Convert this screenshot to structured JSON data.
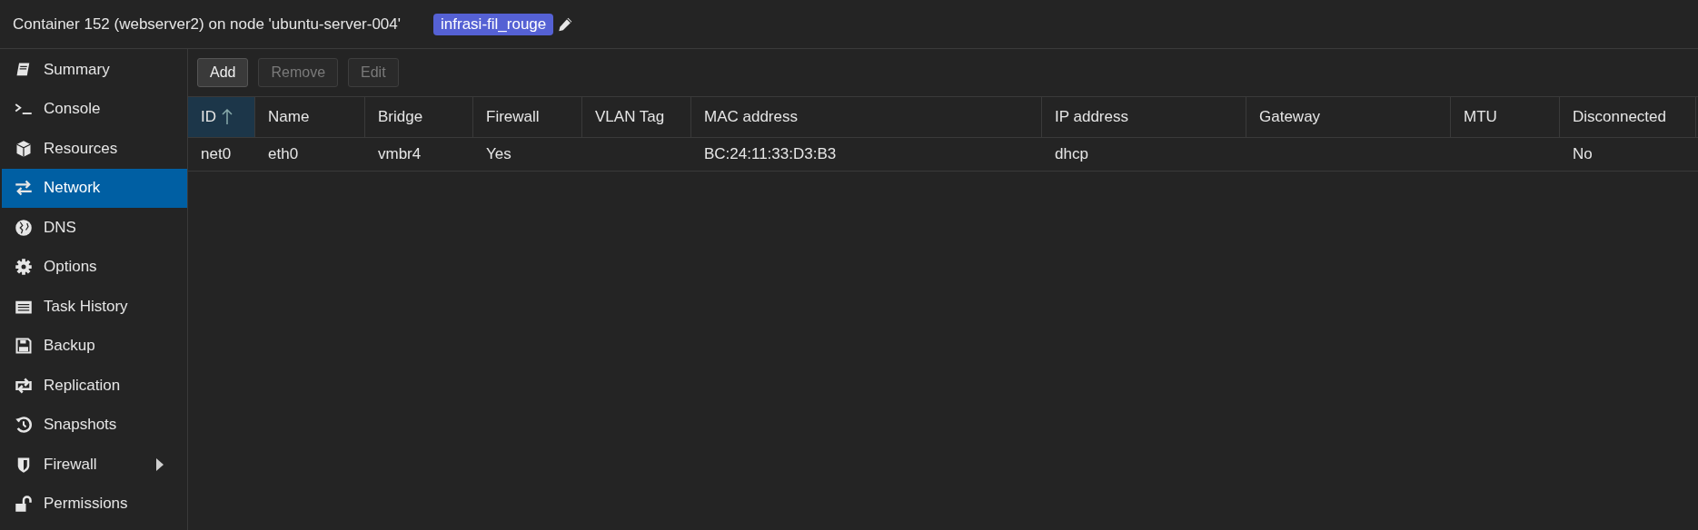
{
  "header": {
    "title": "Container 152 (webserver2) on node 'ubuntu-server-004'",
    "tags": [
      {
        "label": "infrasi-fil_rouge"
      }
    ]
  },
  "sidebar": {
    "items": [
      {
        "label": "Summary",
        "selected": false,
        "expandable": false
      },
      {
        "label": "Console",
        "selected": false,
        "expandable": false
      },
      {
        "label": "Resources",
        "selected": false,
        "expandable": false
      },
      {
        "label": "Network",
        "selected": true,
        "expandable": false
      },
      {
        "label": "DNS",
        "selected": false,
        "expandable": false
      },
      {
        "label": "Options",
        "selected": false,
        "expandable": false
      },
      {
        "label": "Task History",
        "selected": false,
        "expandable": false
      },
      {
        "label": "Backup",
        "selected": false,
        "expandable": false
      },
      {
        "label": "Replication",
        "selected": false,
        "expandable": false
      },
      {
        "label": "Snapshots",
        "selected": false,
        "expandable": false
      },
      {
        "label": "Firewall",
        "selected": false,
        "expandable": true
      },
      {
        "label": "Permissions",
        "selected": false,
        "expandable": false
      }
    ]
  },
  "toolbar": {
    "buttons": [
      {
        "label": "Add",
        "disabled": false
      },
      {
        "label": "Remove",
        "disabled": true
      },
      {
        "label": "Edit",
        "disabled": true
      }
    ]
  },
  "table": {
    "columns": [
      {
        "label": "ID",
        "sorted": true
      },
      {
        "label": "Name",
        "sorted": false
      },
      {
        "label": "Bridge",
        "sorted": false
      },
      {
        "label": "Firewall",
        "sorted": false
      },
      {
        "label": "VLAN Tag",
        "sorted": false
      },
      {
        "label": "MAC address",
        "sorted": false
      },
      {
        "label": "IP address",
        "sorted": false
      },
      {
        "label": "Gateway",
        "sorted": false
      },
      {
        "label": "MTU",
        "sorted": false
      },
      {
        "label": "Disconnected",
        "sorted": false
      }
    ],
    "rows": [
      {
        "id": "net0",
        "name": "eth0",
        "bridge": "vmbr4",
        "firewall": "Yes",
        "mac_address": "BC:24:11:33:D3:B3",
        "ip_address": "dhcp",
        "disconnected": "No"
      }
    ]
  }
}
